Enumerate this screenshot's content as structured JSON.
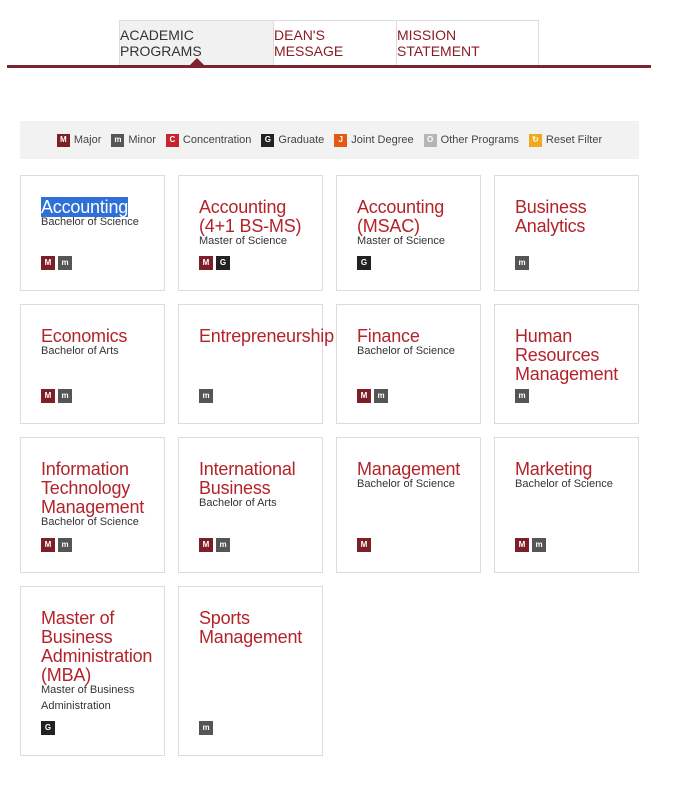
{
  "tabs": [
    {
      "label": "ACADEMIC PROGRAMS",
      "active": true
    },
    {
      "label": "DEAN'S MESSAGE",
      "active": false
    },
    {
      "label": "MISSION STATEMENT",
      "active": false
    }
  ],
  "legend": [
    {
      "letter": "M",
      "label": "Major",
      "color": "#7d1f27"
    },
    {
      "letter": "m",
      "label": "Minor",
      "color": "#555555"
    },
    {
      "letter": "C",
      "label": "Concentration",
      "color": "#c6232b"
    },
    {
      "letter": "G",
      "label": "Graduate",
      "color": "#222222"
    },
    {
      "letter": "J",
      "label": "Joint Degree",
      "color": "#e35a13"
    },
    {
      "letter": "O",
      "label": "Other Programs",
      "color": "#b5b5b5"
    },
    {
      "letter": "↻",
      "label": "Reset Filter",
      "color": "#f2a81d"
    }
  ],
  "programs": [
    {
      "title": "Accounting",
      "highlighted": true,
      "degree": "Bachelor of Science",
      "badges": [
        "M",
        "m"
      ]
    },
    {
      "title": "Accounting (4+1 BS-MS)",
      "degree": "Master of Science",
      "badges": [
        "M",
        "G"
      ]
    },
    {
      "title": "Accounting (MSAC)",
      "degree": "Master of Science",
      "badges": [
        "G"
      ]
    },
    {
      "title": "Business Analytics",
      "degree": "",
      "badges": [
        "m"
      ]
    },
    {
      "title": "Economics",
      "degree": "Bachelor of Arts",
      "badges": [
        "M",
        "m"
      ]
    },
    {
      "title": "Entrepreneurship",
      "degree": "",
      "badges": [
        "m"
      ]
    },
    {
      "title": "Finance",
      "degree": "Bachelor of Science",
      "badges": [
        "M",
        "m"
      ]
    },
    {
      "title": "Human Resources Management",
      "degree": "",
      "badges": [
        "m"
      ]
    },
    {
      "title": "Information Technology Management",
      "degree": "Bachelor of Science",
      "badges": [
        "M",
        "m"
      ]
    },
    {
      "title": "International Business",
      "degree": "Bachelor of Arts",
      "badges": [
        "M",
        "m"
      ]
    },
    {
      "title": "Management",
      "degree": "Bachelor of Science",
      "badges": [
        "M"
      ]
    },
    {
      "title": "Marketing",
      "degree": "Bachelor of Science",
      "badges": [
        "M",
        "m"
      ]
    },
    {
      "title": "Master of Business Administration (MBA)",
      "degree": "Master of Business Administration",
      "badges": [
        "G"
      ]
    },
    {
      "title": "Sports Management",
      "degree": "",
      "badges": [
        "m"
      ]
    }
  ]
}
